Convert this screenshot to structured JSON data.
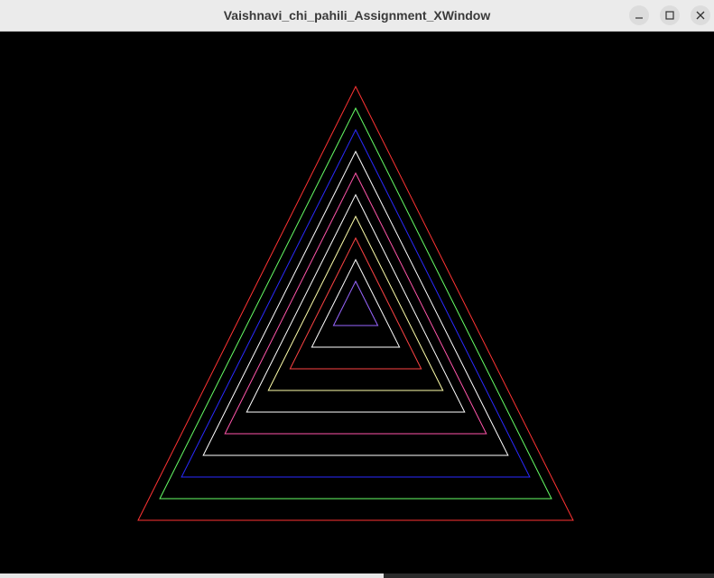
{
  "window": {
    "title": "Vaishnavi_chi_pahili_Assignment_XWindow",
    "background": "#000000"
  },
  "controls": {
    "minimize_icon": "minimize-icon",
    "maximize_icon": "maximize-icon",
    "close_icon": "close-icon"
  },
  "triangles": [
    {
      "color": "#ff3333"
    },
    {
      "color": "#66ff66"
    },
    {
      "color": "#2a2aff"
    },
    {
      "color": "#ffffff"
    },
    {
      "color": "#ff55aa"
    },
    {
      "color": "#ffffff"
    },
    {
      "color": "#ffffaa"
    },
    {
      "color": "#ff4444"
    },
    {
      "color": "#ffffff"
    },
    {
      "color": "#9966ff"
    }
  ]
}
